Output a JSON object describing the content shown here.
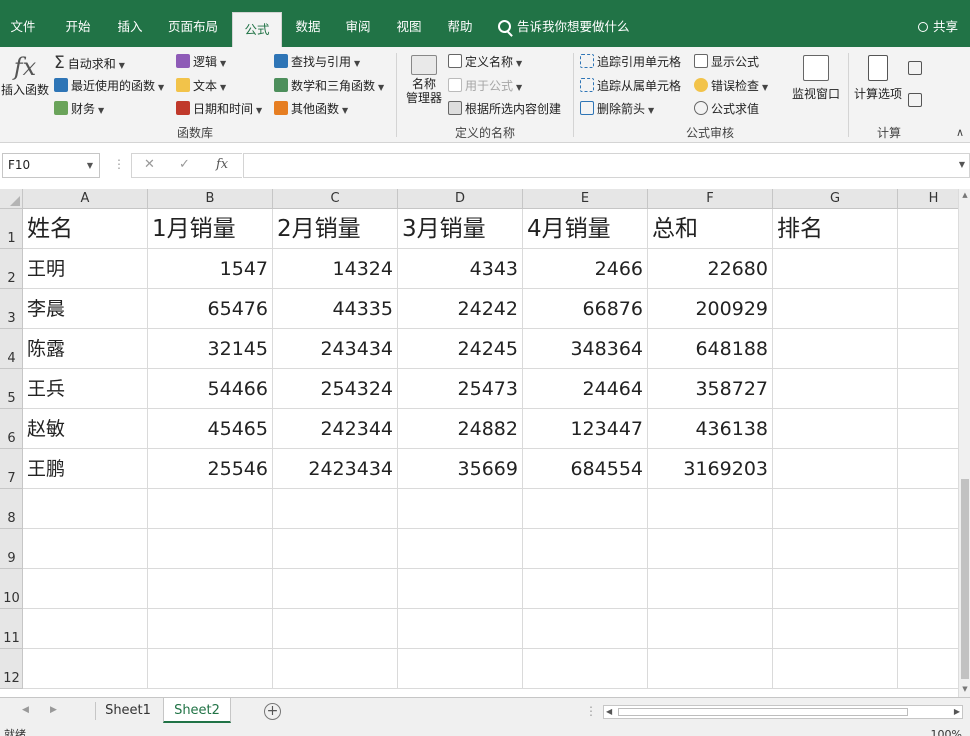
{
  "ribbon_tabs": [
    "文件",
    "开始",
    "插入",
    "页面布局",
    "公式",
    "数据",
    "审阅",
    "视图",
    "帮助"
  ],
  "active_tab": "公式",
  "tell_me": "告诉我你想要做什么",
  "share": "共享",
  "ribbon": {
    "insert_function": "插入函数",
    "autosum": "自动求和",
    "recently_used": "最近使用的函数",
    "financial": "财务",
    "logical": "逻辑",
    "text": "文本",
    "date_time": "日期和时间",
    "lookup_ref": "查找与引用",
    "math_trig": "数学和三角函数",
    "more_functions": "其他函数",
    "function_library_label": "函数库",
    "name_manager": "名称\n管理器",
    "define_name": "定义名称",
    "use_in_formula": "用于公式",
    "create_from_selection": "根据所选内容创建",
    "defined_names_label": "定义的名称",
    "trace_precedents": "追踪引用单元格",
    "trace_dependents": "追踪从属单元格",
    "remove_arrows": "删除箭头",
    "show_formulas": "显示公式",
    "error_checking": "错误检查",
    "evaluate_formula": "公式求值",
    "formula_auditing_label": "公式审核",
    "watch_window": "监视窗口",
    "calc_options": "计算选项",
    "calculation_label": "计算"
  },
  "formula_bar": {
    "name_box": "F10",
    "cancel": "✕",
    "enter": "✓",
    "fx": "fx",
    "content": ""
  },
  "columns": [
    "A",
    "B",
    "C",
    "D",
    "E",
    "F",
    "G",
    "H"
  ],
  "rows": [
    "1",
    "2",
    "3",
    "4",
    "5",
    "6",
    "7",
    "8",
    "9",
    "10",
    "11",
    "12"
  ],
  "table": {
    "headers": [
      "姓名",
      "1月销量",
      "2月销量",
      "3月销量",
      "4月销量",
      "总和",
      "排名"
    ],
    "records": [
      [
        "王明",
        "1547",
        "14324",
        "4343",
        "2466",
        "22680",
        ""
      ],
      [
        "李晨",
        "65476",
        "44335",
        "24242",
        "66876",
        "200929",
        ""
      ],
      [
        "陈露",
        "32145",
        "243434",
        "24245",
        "348364",
        "648188",
        ""
      ],
      [
        "王兵",
        "54466",
        "254324",
        "25473",
        "24464",
        "358727",
        ""
      ],
      [
        "赵敏",
        "45465",
        "242344",
        "24882",
        "123447",
        "436138",
        ""
      ],
      [
        "王鹏",
        "25546",
        "2423434",
        "35669",
        "684554",
        "3169203",
        ""
      ]
    ]
  },
  "sheets": [
    "Sheet1",
    "Sheet2"
  ],
  "active_sheet": "Sheet2",
  "status": "就绪",
  "zoom": "100%",
  "colors": {
    "brand": "#217346",
    "ribbon_bg": "#f3f3f3",
    "grid_line": "#dadada",
    "header_bg": "#e6e6e6"
  }
}
